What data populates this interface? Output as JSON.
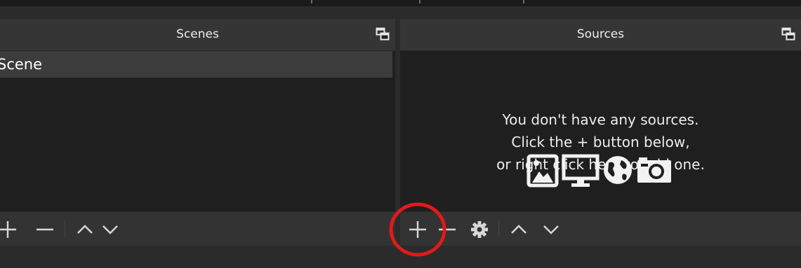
{
  "scenes": {
    "title": "Scenes",
    "items": [
      {
        "label": "Scene"
      }
    ],
    "toolbar": {
      "add_icon": "plus-icon",
      "remove_icon": "minus-icon",
      "up_icon": "chevron-up-icon",
      "down_icon": "chevron-down-icon"
    }
  },
  "sources": {
    "title": "Sources",
    "empty_message": [
      "You don't have any sources.",
      "Click the + button below,",
      "or right click here to add one."
    ],
    "empty_icons": [
      "image-icon",
      "monitor-icon",
      "globe-icon",
      "camera-icon"
    ],
    "toolbar": {
      "add_icon": "plus-icon",
      "remove_icon": "minus-icon",
      "settings_icon": "gear-icon",
      "up_icon": "chevron-up-icon",
      "down_icon": "chevron-down-icon"
    }
  },
  "annotation": {
    "type": "red-circle",
    "target": "sources-add-button",
    "color": "#e11a1a"
  },
  "colors": {
    "background": "#2b2b2b",
    "panel": "#1f1f1f",
    "titlebar": "#353535",
    "selected_item": "#3c3c3c",
    "toolbar": "#333333",
    "text": "#ededed"
  }
}
